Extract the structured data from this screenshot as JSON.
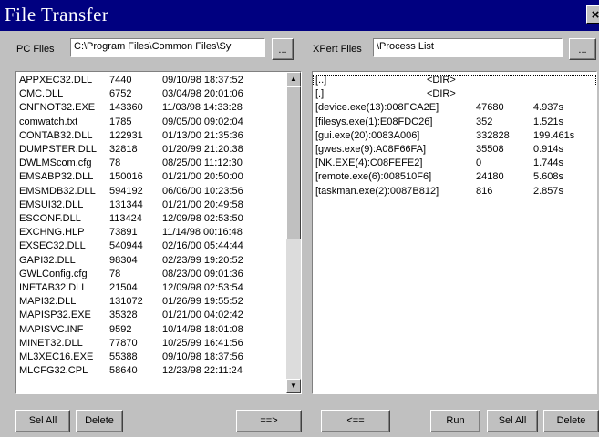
{
  "window": {
    "title": "File Transfer",
    "close_icon": "×"
  },
  "pc": {
    "label": "PC Files",
    "path": "C:\\Program Files\\Common Files\\Sy",
    "browse_label": "...",
    "files": [
      {
        "name": "APPXEC32.DLL",
        "size": "7440",
        "date": "09/10/98 18:37:52"
      },
      {
        "name": "CMC.DLL",
        "size": "6752",
        "date": "03/04/98 20:01:06"
      },
      {
        "name": "CNFNOT32.EXE",
        "size": "143360",
        "date": "11/03/98 14:33:28"
      },
      {
        "name": "comwatch.txt",
        "size": "1785",
        "date": "09/05/00 09:02:04"
      },
      {
        "name": "CONTAB32.DLL",
        "size": "122931",
        "date": "01/13/00 21:35:36"
      },
      {
        "name": "DUMPSTER.DLL",
        "size": "32818",
        "date": "01/20/99 21:20:38"
      },
      {
        "name": "DWLMScom.cfg",
        "size": "78",
        "date": "08/25/00 11:12:30"
      },
      {
        "name": "EMSABP32.DLL",
        "size": "150016",
        "date": "01/21/00 20:50:00"
      },
      {
        "name": "EMSMDB32.DLL",
        "size": "594192",
        "date": "06/06/00 10:23:56"
      },
      {
        "name": "EMSUI32.DLL",
        "size": "131344",
        "date": "01/21/00 20:49:58"
      },
      {
        "name": "ESCONF.DLL",
        "size": "113424",
        "date": "12/09/98 02:53:50"
      },
      {
        "name": "EXCHNG.HLP",
        "size": "73891",
        "date": "11/14/98 00:16:48"
      },
      {
        "name": "EXSEC32.DLL",
        "size": "540944",
        "date": "02/16/00 05:44:44"
      },
      {
        "name": "GAPI32.DLL",
        "size": "98304",
        "date": "02/23/99 19:20:52"
      },
      {
        "name": "GWLConfig.cfg",
        "size": "78",
        "date": "08/23/00 09:01:36"
      },
      {
        "name": "INETAB32.DLL",
        "size": "21504",
        "date": "12/09/98 02:53:54"
      },
      {
        "name": "MAPI32.DLL",
        "size": "131072",
        "date": "01/26/99 19:55:52"
      },
      {
        "name": "MAPISP32.EXE",
        "size": "35328",
        "date": "01/21/00 04:02:42"
      },
      {
        "name": "MAPISVC.INF",
        "size": "9592",
        "date": "10/14/98 18:01:08"
      },
      {
        "name": "MINET32.DLL",
        "size": "77870",
        "date": "10/25/99 16:41:56"
      },
      {
        "name": "ML3XEC16.EXE",
        "size": "55388",
        "date": "09/10/98 18:37:56"
      },
      {
        "name": "MLCFG32.CPL",
        "size": "58640",
        "date": "12/23/98 22:11:24"
      }
    ]
  },
  "xpert": {
    "label": "XPert Files",
    "path": "\\Process List",
    "browse_label": "...",
    "files": [
      {
        "name": "[..]",
        "size": "<DIR>",
        "time": ""
      },
      {
        "name": "[.]",
        "size": "<DIR>",
        "time": ""
      },
      {
        "name": "[device.exe(13):008FCA2E]",
        "size": "47680",
        "time": "4.937s"
      },
      {
        "name": "[filesys.exe(1):E08FDC26]",
        "size": "352",
        "time": "1.521s"
      },
      {
        "name": "[gui.exe(20):0083A006]",
        "size": "332828",
        "time": "199.461s"
      },
      {
        "name": "[gwes.exe(9):A08F66FA]",
        "size": "35508",
        "time": "0.914s"
      },
      {
        "name": "[NK.EXE(4):C08FEFE2]",
        "size": "0",
        "time": "1.744s"
      },
      {
        "name": "[remote.exe(6):008510F6]",
        "size": "24180",
        "time": "5.608s"
      },
      {
        "name": "[taskman.exe(2):0087B812]",
        "size": "816",
        "time": "2.857s"
      }
    ]
  },
  "buttons": {
    "sel_all_left": "Sel All",
    "delete_left": "Delete",
    "copy_right": "==>",
    "copy_left": "<==",
    "run": "Run",
    "sel_all_right": "Sel All",
    "delete_right": "Delete"
  }
}
